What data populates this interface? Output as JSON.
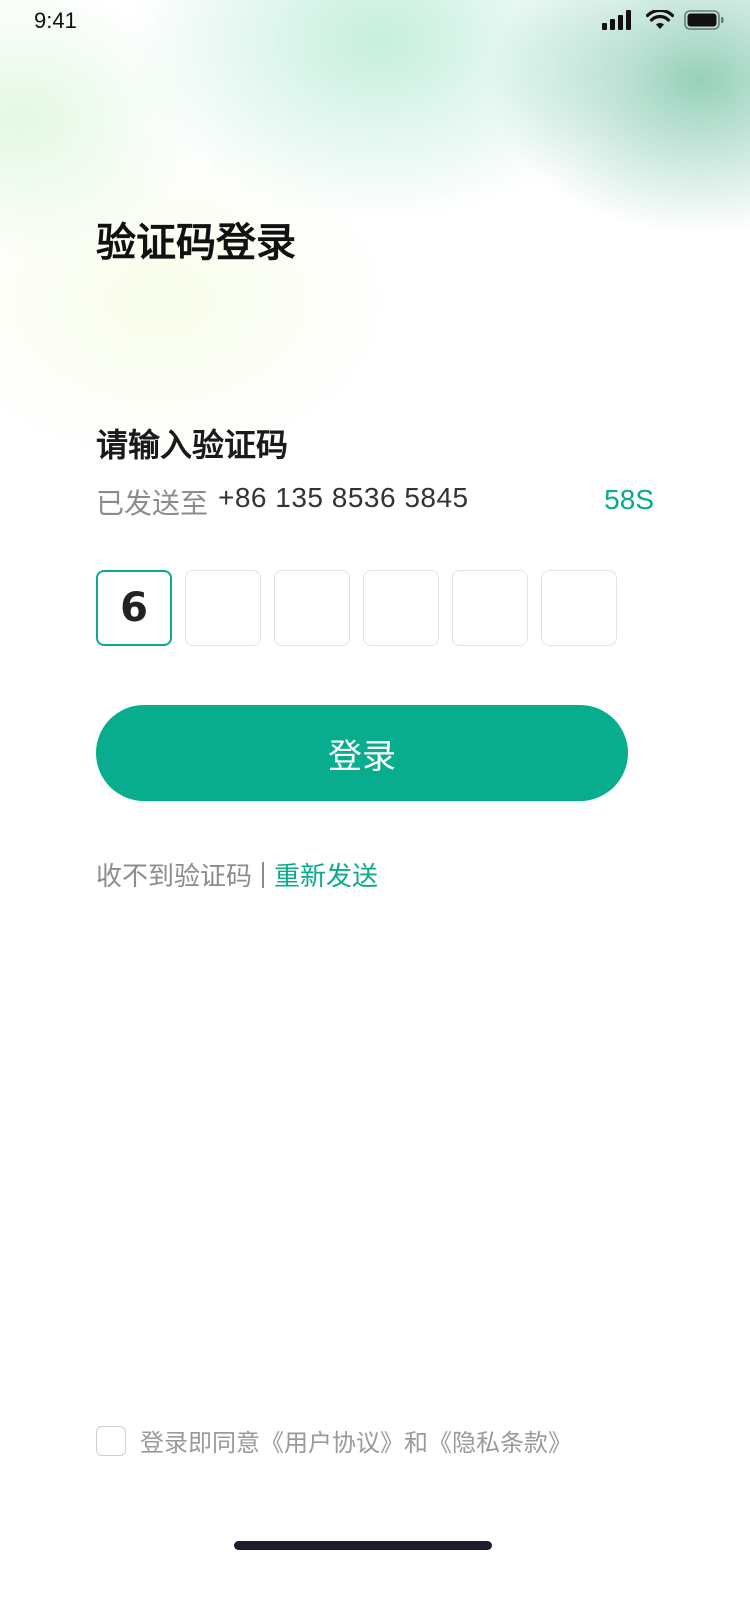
{
  "status_bar": {
    "time": "9:41",
    "icons": [
      "cellular-signal-icon",
      "wifi-icon",
      "battery-icon"
    ]
  },
  "page": {
    "title": "验证码登录"
  },
  "verify": {
    "heading": "请输入验证码",
    "sent_label": "已发送至",
    "phone": "+86  135 8536 5845",
    "countdown": "58S",
    "code_digits": [
      "6",
      "",
      "",
      "",
      "",
      ""
    ]
  },
  "login_button": {
    "label": "登录"
  },
  "resend": {
    "hint": "收不到验证码",
    "link": "重新发送"
  },
  "agreement": {
    "text": "登录即同意《用户协议》和《隐私条款》",
    "checked": false
  },
  "colors": {
    "accent": "#07ad8d",
    "text_primary": "#111111",
    "text_secondary": "#8c8c8c"
  }
}
